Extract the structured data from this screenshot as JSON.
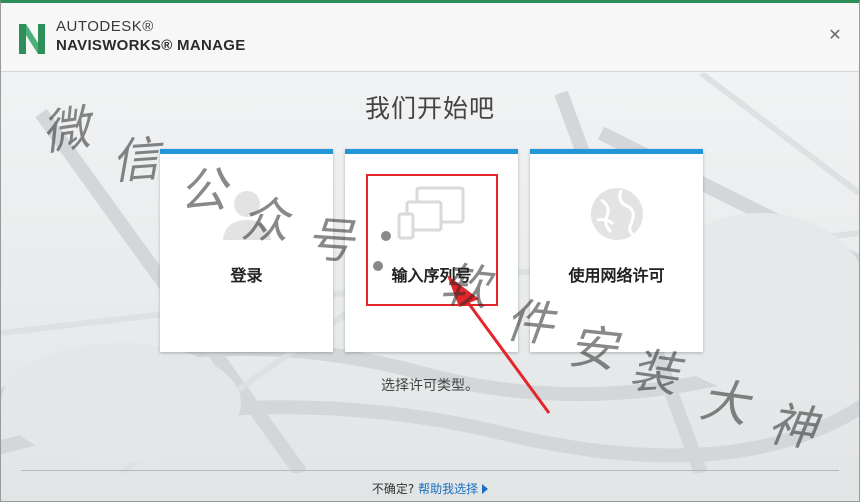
{
  "window": {
    "brand_top": "AUTODESK®",
    "brand_bottom": "NAVISWORKS® MANAGE",
    "close_symbol": "✕",
    "accent_color": "#2f8f5b"
  },
  "main": {
    "heading": "我们开始吧",
    "cards": [
      {
        "label": "登录",
        "icon": "user-icon"
      },
      {
        "label": "输入序列号",
        "icon": "devices-icon"
      },
      {
        "label": "使用网络许可",
        "icon": "globe-icon"
      }
    ],
    "hint": "选择许可类型。",
    "card_accent": "#2196d8"
  },
  "footer": {
    "question": "不确定?",
    "help_link": "帮助我选择"
  },
  "watermark": {
    "chars": [
      "微",
      "信",
      "公",
      "众",
      "号",
      "软",
      "件",
      "安",
      "装",
      "大",
      "神"
    ]
  }
}
